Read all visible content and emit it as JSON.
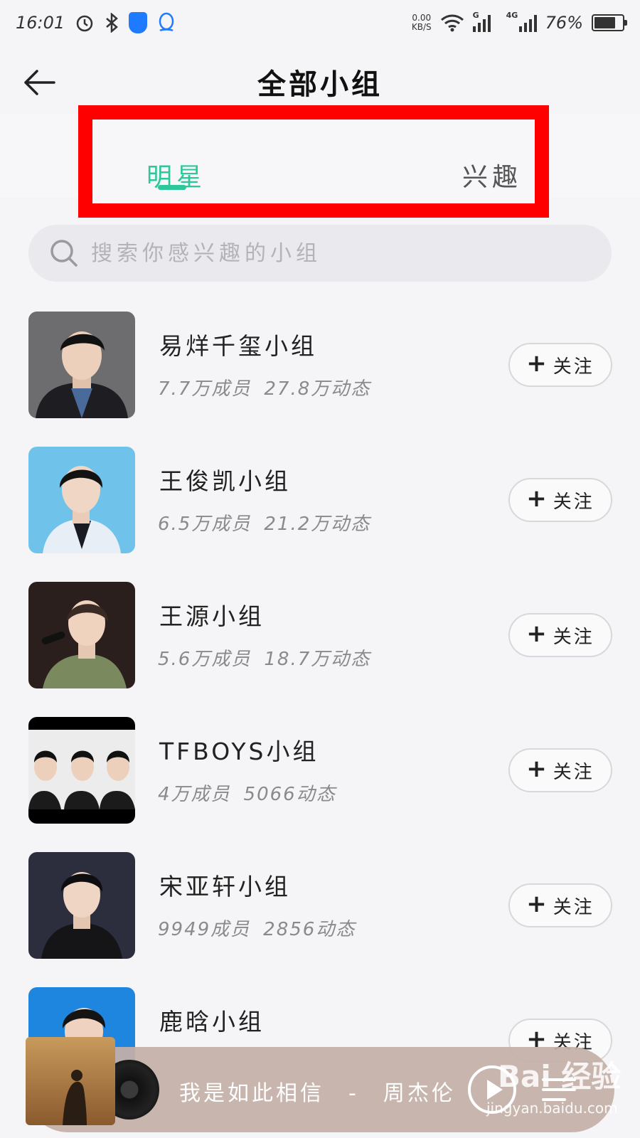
{
  "status_bar": {
    "time": "16:01",
    "net_speed_value": "0.00",
    "net_speed_unit": "KB/S",
    "signal_1_label": "G",
    "signal_2_label": "4G",
    "battery": "76%",
    "battery_level": 0.76
  },
  "header": {
    "title": "全部小组"
  },
  "tabs": [
    {
      "label": "明星",
      "active": true
    },
    {
      "label": "兴趣",
      "active": false
    }
  ],
  "search": {
    "placeholder": "搜索你感兴趣的小组"
  },
  "groups": [
    {
      "name": "易烊千玺小组",
      "members": "7.7万成员",
      "posts": "27.8万动态",
      "follow_label": "关注"
    },
    {
      "name": "王俊凯小组",
      "members": "6.5万成员",
      "posts": "21.2万动态",
      "follow_label": "关注"
    },
    {
      "name": "王源小组",
      "members": "5.6万成员",
      "posts": "18.7万动态",
      "follow_label": "关注"
    },
    {
      "name": "TFBOYS小组",
      "members": "4万成员",
      "posts": "5066动态",
      "follow_label": "关注"
    },
    {
      "name": "宋亚轩小组",
      "members": "9949成员",
      "posts": "2856动态",
      "follow_label": "关注"
    },
    {
      "name": "鹿晗小组",
      "members": "",
      "posts": "",
      "follow_label": "关注"
    }
  ],
  "player": {
    "song": "我是如此相信　-　周杰伦"
  },
  "watermark": {
    "brand": "Bai 经验",
    "url": "jingyan.baidu.com"
  },
  "colors": {
    "accent": "#2ec79a",
    "highlight_box": "#ff0000"
  }
}
